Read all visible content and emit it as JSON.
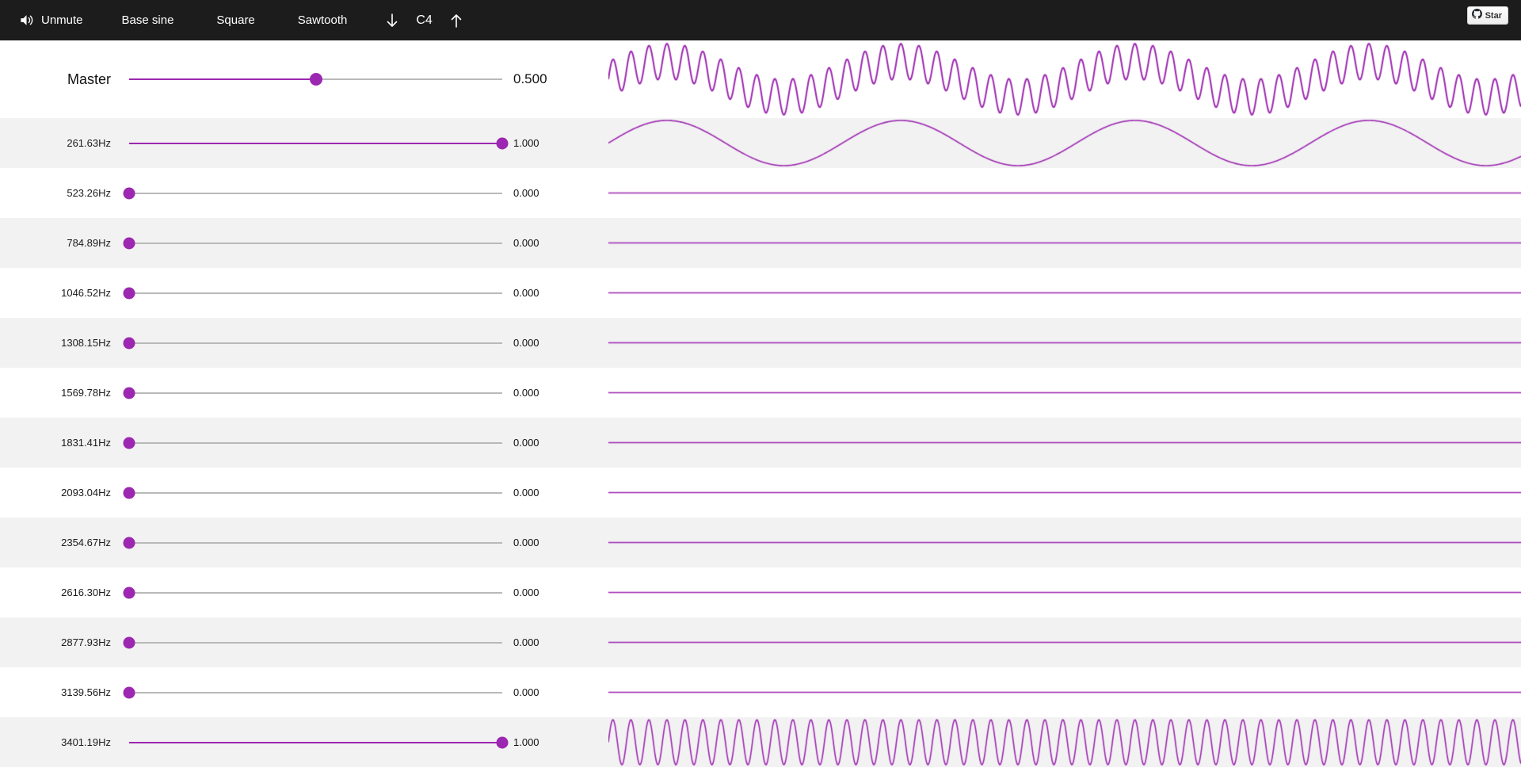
{
  "toolbar": {
    "mute_label": "Unmute",
    "base_sine_label": "Base sine",
    "square_label": "Square",
    "sawtooth_label": "Sawtooth",
    "octave_down_icon": "arrow-down",
    "note": "C4",
    "octave_up_icon": "arrow-up",
    "github_star_label": "Star"
  },
  "master": {
    "label": "Master",
    "value": "0.500",
    "numeric": 0.5
  },
  "harmonics": [
    {
      "n": 1,
      "label": "261.63Hz",
      "value": "1.000",
      "numeric": 1
    },
    {
      "n": 2,
      "label": "523.26Hz",
      "value": "0.000",
      "numeric": 0
    },
    {
      "n": 3,
      "label": "784.89Hz",
      "value": "0.000",
      "numeric": 0
    },
    {
      "n": 4,
      "label": "1046.52Hz",
      "value": "0.000",
      "numeric": 0
    },
    {
      "n": 5,
      "label": "1308.15Hz",
      "value": "0.000",
      "numeric": 0
    },
    {
      "n": 6,
      "label": "1569.78Hz",
      "value": "0.000",
      "numeric": 0
    },
    {
      "n": 7,
      "label": "1831.41Hz",
      "value": "0.000",
      "numeric": 0
    },
    {
      "n": 8,
      "label": "2093.04Hz",
      "value": "0.000",
      "numeric": 0
    },
    {
      "n": 9,
      "label": "2354.67Hz",
      "value": "0.000",
      "numeric": 0
    },
    {
      "n": 10,
      "label": "2616.30Hz",
      "value": "0.000",
      "numeric": 0
    },
    {
      "n": 11,
      "label": "2877.93Hz",
      "value": "0.000",
      "numeric": 0
    },
    {
      "n": 12,
      "label": "3139.56Hz",
      "value": "0.000",
      "numeric": 0
    },
    {
      "n": 13,
      "label": "3401.19Hz",
      "value": "1.000",
      "numeric": 1
    }
  ],
  "waveform": {
    "type": "line",
    "fundamental_cycles_visible": 3.9,
    "master_is_sum_of_harmonics": true,
    "harmonic_line_width": 1.6,
    "master_line_width": 2
  },
  "colors": {
    "accent": "#9c27b0",
    "toolbar_bg": "#1c1c1c",
    "stripe": "#f2f2f2",
    "track": "#b9b9b9"
  }
}
